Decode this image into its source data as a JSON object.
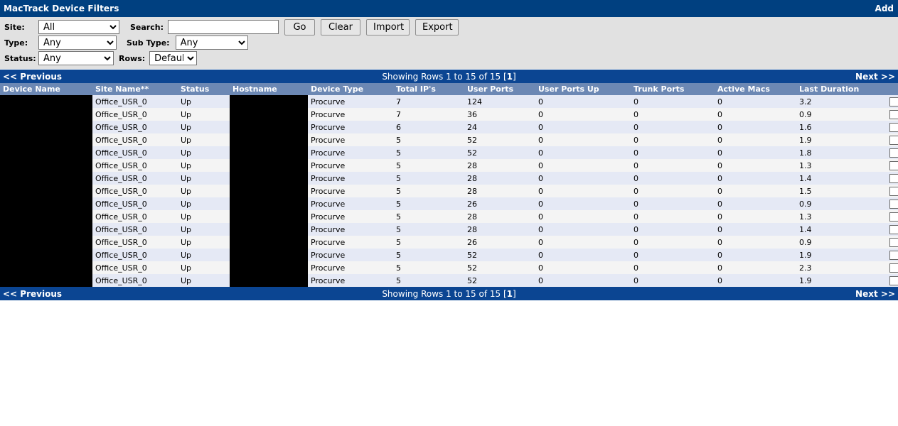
{
  "window": {
    "title": "MacTrack Device Filters",
    "add_label": "Add"
  },
  "filters": {
    "site_label": "Site:",
    "site_value": "All",
    "site_options": [
      "All"
    ],
    "search_label": "Search:",
    "search_value": "",
    "search_placeholder": "",
    "go_label": "Go",
    "clear_label": "Clear",
    "import_label": "Import",
    "export_label": "Export",
    "type_label": "Type:",
    "type_value": "Any",
    "type_options": [
      "Any"
    ],
    "subtype_label": "Sub Type:",
    "subtype_value": "Any",
    "subtype_options": [
      "Any"
    ],
    "status_label": "Status:",
    "status_value": "Any",
    "status_options": [
      "Any"
    ],
    "rows_label": "Rows:",
    "rows_value": "Default",
    "rows_options": [
      "Default"
    ]
  },
  "pager": {
    "previous_label": "<< Previous",
    "next_label": "Next >>",
    "showing_prefix": "Showing Rows 1 to 15 of 15 [",
    "showing_page": "1",
    "showing_suffix": "]"
  },
  "table": {
    "columns": [
      "Device Name",
      "Site Name**",
      "Status",
      "Hostname",
      "Device Type",
      "Total IP's",
      "User Ports",
      "User Ports Up",
      "Trunk Ports",
      "Active Macs",
      "Last Duration"
    ],
    "rows": [
      {
        "device_name": "",
        "site_name": "Office_USR_0",
        "status": "Up",
        "hostname": "",
        "device_type": "Procurve",
        "total_ips": "7",
        "user_ports": "124",
        "user_ports_up": "0",
        "trunk_ports": "0",
        "active_macs": "0",
        "last_duration": "3.2"
      },
      {
        "device_name": "",
        "site_name": "Office_USR_0",
        "status": "Up",
        "hostname": "",
        "device_type": "Procurve",
        "total_ips": "7",
        "user_ports": "36",
        "user_ports_up": "0",
        "trunk_ports": "0",
        "active_macs": "0",
        "last_duration": "0.9"
      },
      {
        "device_name": "",
        "site_name": "Office_USR_0",
        "status": "Up",
        "hostname": "",
        "device_type": "Procurve",
        "total_ips": "6",
        "user_ports": "24",
        "user_ports_up": "0",
        "trunk_ports": "0",
        "active_macs": "0",
        "last_duration": "1.6"
      },
      {
        "device_name": "",
        "site_name": "Office_USR_0",
        "status": "Up",
        "hostname": "",
        "device_type": "Procurve",
        "total_ips": "5",
        "user_ports": "52",
        "user_ports_up": "0",
        "trunk_ports": "0",
        "active_macs": "0",
        "last_duration": "1.9"
      },
      {
        "device_name": "",
        "site_name": "Office_USR_0",
        "status": "Up",
        "hostname": "",
        "device_type": "Procurve",
        "total_ips": "5",
        "user_ports": "52",
        "user_ports_up": "0",
        "trunk_ports": "0",
        "active_macs": "0",
        "last_duration": "1.8"
      },
      {
        "device_name": "",
        "site_name": "Office_USR_0",
        "status": "Up",
        "hostname": "",
        "device_type": "Procurve",
        "total_ips": "5",
        "user_ports": "28",
        "user_ports_up": "0",
        "trunk_ports": "0",
        "active_macs": "0",
        "last_duration": "1.3"
      },
      {
        "device_name": "",
        "site_name": "Office_USR_0",
        "status": "Up",
        "hostname": "",
        "device_type": "Procurve",
        "total_ips": "5",
        "user_ports": "28",
        "user_ports_up": "0",
        "trunk_ports": "0",
        "active_macs": "0",
        "last_duration": "1.4"
      },
      {
        "device_name": "",
        "site_name": "Office_USR_0",
        "status": "Up",
        "hostname": "",
        "device_type": "Procurve",
        "total_ips": "5",
        "user_ports": "28",
        "user_ports_up": "0",
        "trunk_ports": "0",
        "active_macs": "0",
        "last_duration": "1.5"
      },
      {
        "device_name": "",
        "site_name": "Office_USR_0",
        "status": "Up",
        "hostname": "",
        "device_type": "Procurve",
        "total_ips": "5",
        "user_ports": "26",
        "user_ports_up": "0",
        "trunk_ports": "0",
        "active_macs": "0",
        "last_duration": "0.9"
      },
      {
        "device_name": "",
        "site_name": "Office_USR_0",
        "status": "Up",
        "hostname": "",
        "device_type": "Procurve",
        "total_ips": "5",
        "user_ports": "28",
        "user_ports_up": "0",
        "trunk_ports": "0",
        "active_macs": "0",
        "last_duration": "1.3"
      },
      {
        "device_name": "",
        "site_name": "Office_USR_0",
        "status": "Up",
        "hostname": "",
        "device_type": "Procurve",
        "total_ips": "5",
        "user_ports": "28",
        "user_ports_up": "0",
        "trunk_ports": "0",
        "active_macs": "0",
        "last_duration": "1.4"
      },
      {
        "device_name": "",
        "site_name": "Office_USR_0",
        "status": "Up",
        "hostname": "",
        "device_type": "Procurve",
        "total_ips": "5",
        "user_ports": "26",
        "user_ports_up": "0",
        "trunk_ports": "0",
        "active_macs": "0",
        "last_duration": "0.9"
      },
      {
        "device_name": "",
        "site_name": "Office_USR_0",
        "status": "Up",
        "hostname": "",
        "device_type": "Procurve",
        "total_ips": "5",
        "user_ports": "52",
        "user_ports_up": "0",
        "trunk_ports": "0",
        "active_macs": "0",
        "last_duration": "1.9"
      },
      {
        "device_name": "",
        "site_name": "Office_USR_0",
        "status": "Up",
        "hostname": "",
        "device_type": "Procurve",
        "total_ips": "5",
        "user_ports": "52",
        "user_ports_up": "0",
        "trunk_ports": "0",
        "active_macs": "0",
        "last_duration": "2.3"
      },
      {
        "device_name": "",
        "site_name": "Office_USR_0",
        "status": "Up",
        "hostname": "",
        "device_type": "Procurve",
        "total_ips": "5",
        "user_ports": "52",
        "user_ports_up": "0",
        "trunk_ports": "0",
        "active_macs": "0",
        "last_duration": "1.9"
      }
    ]
  },
  "colors": {
    "titlebar": "#004080",
    "navbar": "#0b4592",
    "column_header": "#6c88b4",
    "row_odd": "#e5e9f5",
    "row_even": "#f4f4f4",
    "filter_panel": "#e1e1e1",
    "status_up": "#118811",
    "redaction": "#000000"
  }
}
